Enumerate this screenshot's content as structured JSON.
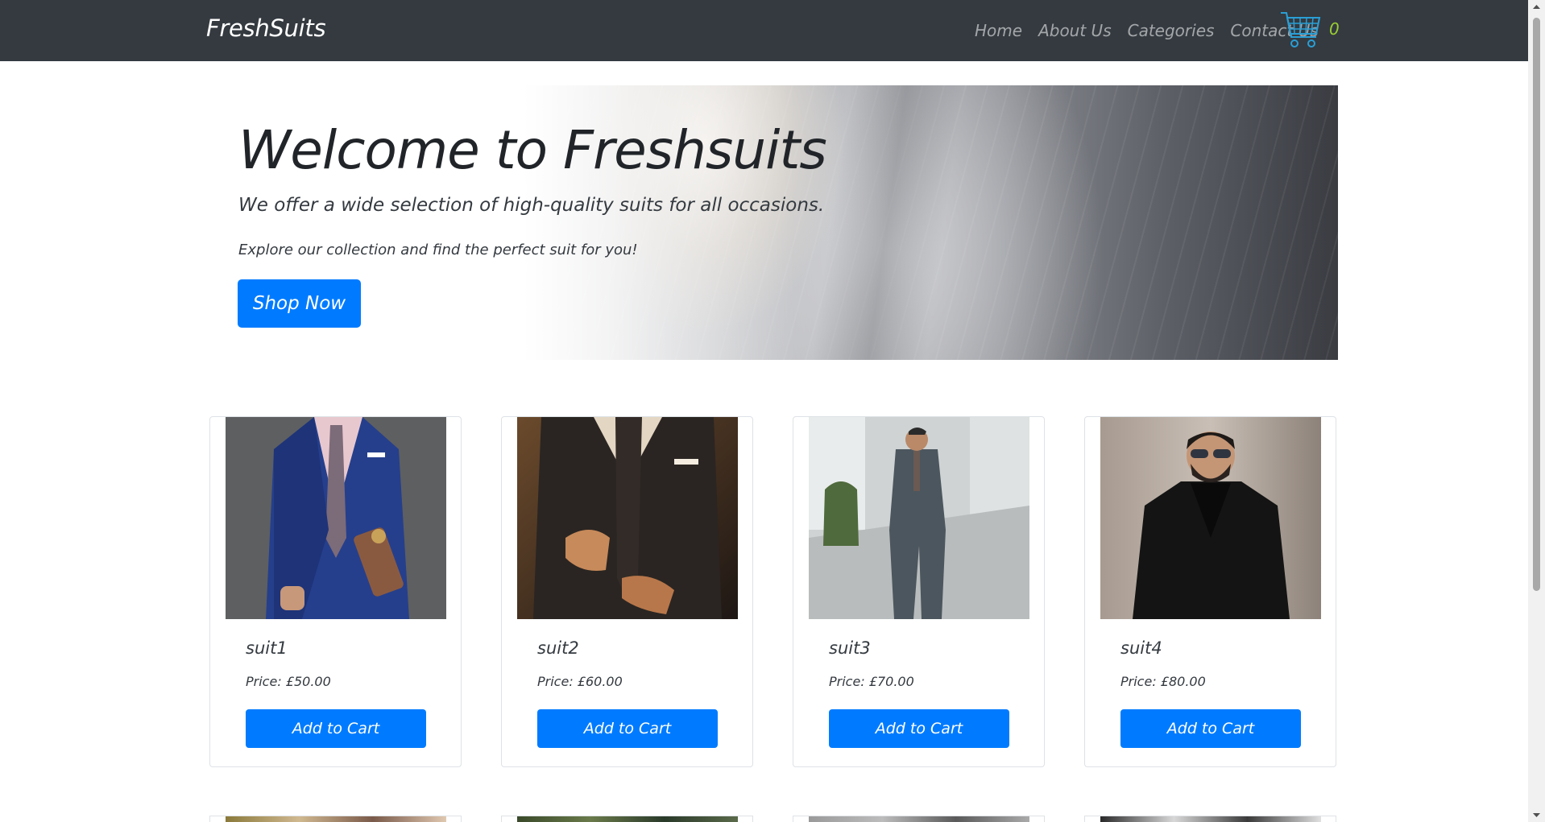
{
  "navbar": {
    "brand": "FreshSuits",
    "links": [
      {
        "label": "Home"
      },
      {
        "label": "About Us"
      },
      {
        "label": "Categories"
      },
      {
        "label": "Contact Us"
      }
    ],
    "cart_icon": "shopping-cart-icon",
    "cart_count": "0",
    "colors": {
      "background": "#343a40",
      "cart_count": "#9acd32",
      "cart_icon": "#2a9fd6"
    }
  },
  "hero": {
    "title": "Welcome to Freshsuits",
    "lead": "We offer a wide selection of high-quality suits for all occasions.",
    "text": "Explore our collection and find the perfect suit for you!",
    "button_label": "Shop Now"
  },
  "products": [
    {
      "name": "suit1",
      "price": "Price: £50.00",
      "button_label": "Add to Cart"
    },
    {
      "name": "suit2",
      "price": "Price: £60.00",
      "button_label": "Add to Cart"
    },
    {
      "name": "suit3",
      "price": "Price: £70.00",
      "button_label": "Add to Cart"
    },
    {
      "name": "suit4",
      "price": "Price: £80.00",
      "button_label": "Add to Cart"
    }
  ],
  "accent_color": "#007bff"
}
